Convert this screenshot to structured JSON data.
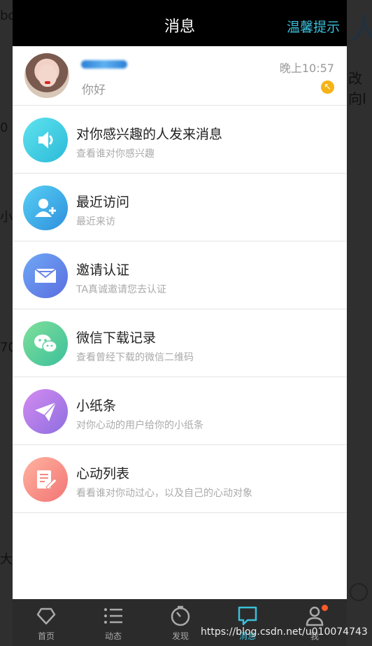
{
  "header": {
    "title": "消息",
    "tip": "温馨提示"
  },
  "user_message": {
    "text": "你好",
    "time": "晚上10:57"
  },
  "items": [
    {
      "title": "对你感兴趣的人发来消息",
      "subtitle": "查看谁对你感兴趣",
      "icon": "speaker-icon"
    },
    {
      "title": "最近访问",
      "subtitle": "最近来访",
      "icon": "add-user-icon"
    },
    {
      "title": "邀请认证",
      "subtitle": "TA真诚邀请您去认证",
      "icon": "envelope-icon"
    },
    {
      "title": "微信下载记录",
      "subtitle": "查看曾经下载的微信二维码",
      "icon": "wechat-icon"
    },
    {
      "title": "小纸条",
      "subtitle": "对你心动的用户给你的小纸条",
      "icon": "paper-plane-icon"
    },
    {
      "title": "心动列表",
      "subtitle": "看看谁对你动过心，以及自己的心动对象",
      "icon": "note-edit-icon"
    }
  ],
  "tabs": [
    {
      "label": "首页",
      "icon": "heart-icon"
    },
    {
      "label": "动态",
      "icon": "list-icon"
    },
    {
      "label": "发现",
      "icon": "compass-icon"
    },
    {
      "label": "消息",
      "icon": "chat-icon",
      "active": true
    },
    {
      "label": "我",
      "icon": "person-icon"
    }
  ],
  "watermark": "https://blog.csdn.net/u010074743",
  "colors": {
    "accent": "#3bbfda",
    "badge": "#f5b317",
    "dot": "#ff5a2b"
  },
  "background_fragments": {
    "left": [
      "bo",
      "0",
      "小",
      "70",
      "大"
    ],
    "right_glyph": "人",
    "right_text": "改向I"
  }
}
